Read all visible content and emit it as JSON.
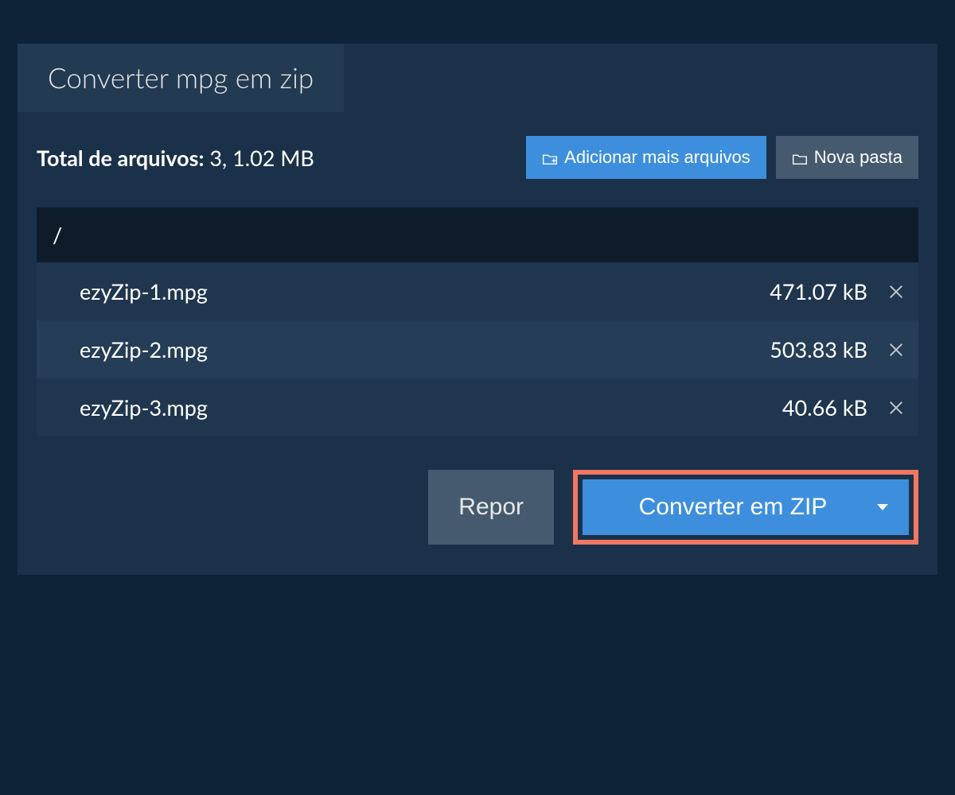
{
  "header": {
    "tab_title": "Converter mpg em zip"
  },
  "summary": {
    "label": "Total de arquivos:",
    "value": " 3, 1.02 MB"
  },
  "actions": {
    "add_files": "Adicionar mais arquivos",
    "new_folder": "Nova pasta"
  },
  "breadcrumb": {
    "path": "/"
  },
  "files": [
    {
      "name": "ezyZip-1.mpg",
      "size": "471.07 kB"
    },
    {
      "name": "ezyZip-2.mpg",
      "size": "503.83 kB"
    },
    {
      "name": "ezyZip-3.mpg",
      "size": "40.66 kB"
    }
  ],
  "footer": {
    "reset": "Repor",
    "convert": "Converter em ZIP"
  },
  "colors": {
    "background": "#0e2338",
    "panel": "#1b3149",
    "tab": "#223a52",
    "primary": "#3d8fdd",
    "secondary": "#455a6e",
    "highlight_border": "#f27762"
  }
}
